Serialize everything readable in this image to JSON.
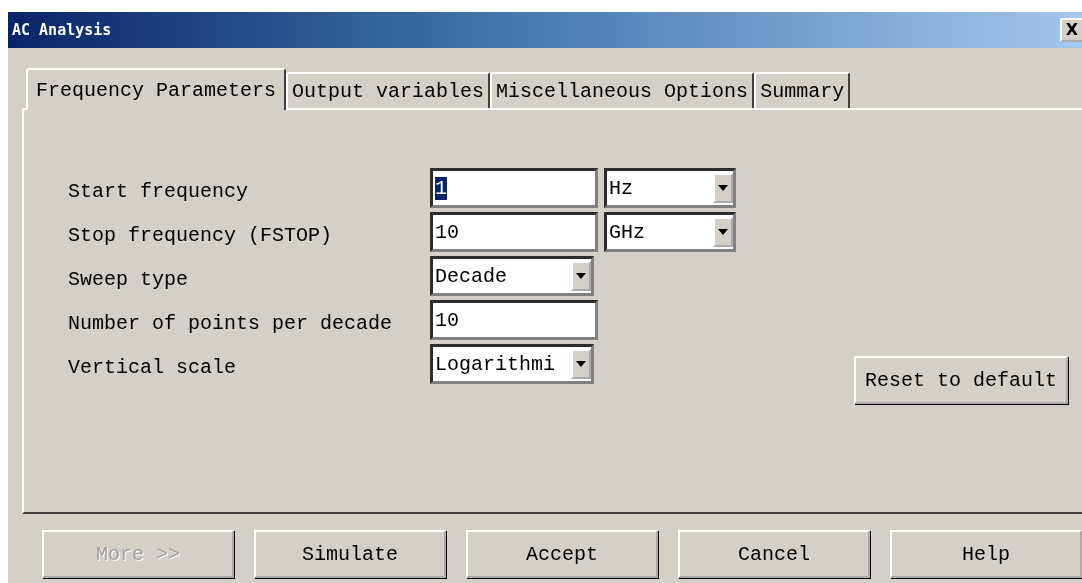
{
  "window": {
    "title": "AC Analysis",
    "close_label": "X"
  },
  "tabs": [
    {
      "label": "Frequency Parameters",
      "selected": true
    },
    {
      "label": "Output variables",
      "selected": false
    },
    {
      "label": "Miscellaneous Options",
      "selected": false
    },
    {
      "label": "Summary",
      "selected": false
    }
  ],
  "fields": [
    {
      "label": "Start frequency",
      "kind": "text",
      "value": "1",
      "text_selected": true,
      "unit": "Hz"
    },
    {
      "label": "Stop frequency (FSTOP)",
      "kind": "text",
      "value": "10",
      "text_selected": false,
      "unit": "GHz"
    },
    {
      "label": "Sweep type",
      "kind": "combo",
      "value": "Decade"
    },
    {
      "label": "Number of points per decade",
      "kind": "text",
      "value": "10",
      "text_selected": false
    },
    {
      "label": "Vertical scale",
      "kind": "combo",
      "value": "Logarithmi"
    }
  ],
  "reset_button": "Reset to default",
  "buttons": [
    {
      "label": "More >>",
      "disabled": true
    },
    {
      "label": "Simulate",
      "disabled": false
    },
    {
      "label": "Accept",
      "disabled": false
    },
    {
      "label": "Cancel",
      "disabled": false
    },
    {
      "label": "Help",
      "disabled": false
    }
  ]
}
